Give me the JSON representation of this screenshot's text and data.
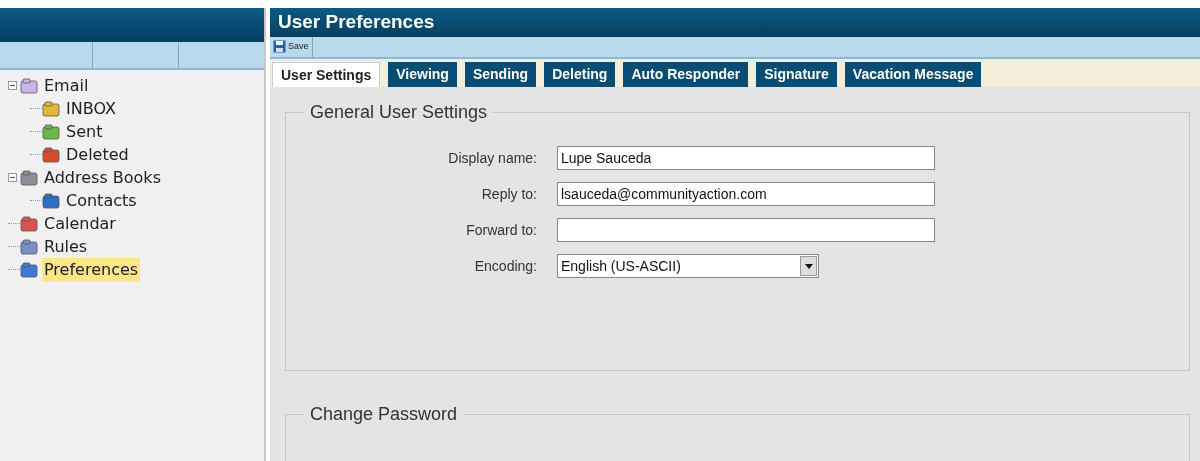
{
  "sidebar": {
    "tree": [
      {
        "label": "Email",
        "kind": "email",
        "expanded": true,
        "selected": false,
        "children": [
          {
            "label": "INBOX",
            "kind": "inbox",
            "selected": false
          },
          {
            "label": "Sent",
            "kind": "sent",
            "selected": false
          },
          {
            "label": "Deleted",
            "kind": "deleted",
            "selected": false
          }
        ]
      },
      {
        "label": "Address Books",
        "kind": "addressbook",
        "expanded": true,
        "selected": false,
        "children": [
          {
            "label": "Contacts",
            "kind": "contacts",
            "selected": false
          }
        ]
      },
      {
        "label": "Calendar",
        "kind": "calendar",
        "selected": false
      },
      {
        "label": "Rules",
        "kind": "rules",
        "selected": false
      },
      {
        "label": "Preferences",
        "kind": "preferences",
        "selected": true
      }
    ]
  },
  "window": {
    "title": "User Preferences"
  },
  "toolbar": {
    "save": "Save"
  },
  "tabs": [
    {
      "label": "User Settings",
      "selected": true
    },
    {
      "label": "Viewing",
      "selected": false
    },
    {
      "label": "Sending",
      "selected": false
    },
    {
      "label": "Deleting",
      "selected": false
    },
    {
      "label": "Auto Responder",
      "selected": false
    },
    {
      "label": "Signature",
      "selected": false
    },
    {
      "label": "Vacation Message",
      "selected": false
    }
  ],
  "general": {
    "legend": "General User Settings",
    "fields": [
      {
        "label": "Display name:",
        "kind": "text",
        "value": "Lupe Sauceda"
      },
      {
        "label": "Reply to:",
        "kind": "text",
        "value": "lsauceda@communityaction.com"
      },
      {
        "label": "Forward to:",
        "kind": "text"
      },
      {
        "label": "Encoding:",
        "kind": "select",
        "value": "English (US-ASCII)"
      }
    ]
  },
  "password": {
    "legend": "Change Password"
  }
}
